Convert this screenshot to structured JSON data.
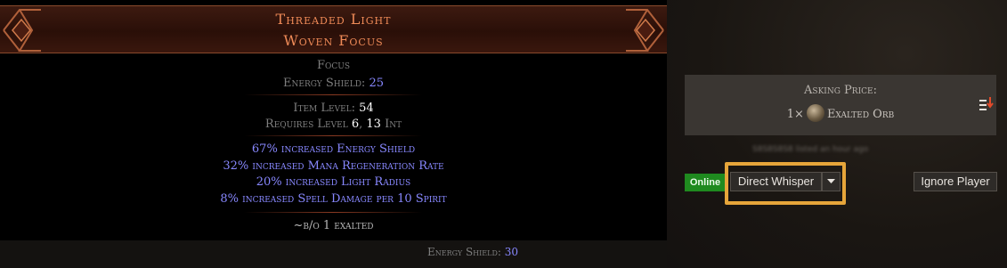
{
  "item": {
    "name_line1": "Threaded Light",
    "name_line2": "Woven Focus",
    "base_type": "Focus",
    "energy_shield_label": "Energy Shield:",
    "energy_shield_value": "25",
    "item_level_label": "Item Level:",
    "item_level_value": "54",
    "requires_prefix": "Requires Level",
    "requires_level": "6",
    "requires_sep": ",",
    "requires_int": "13",
    "requires_int_label": "Int",
    "mods": [
      "67% increased Energy Shield",
      "32% increased Mana Regeneration Rate",
      "20% increased Light Radius",
      "8% increased Spell Damage per 10 Spirit"
    ],
    "note": "~b/o 1 exalted"
  },
  "footer": {
    "energy_shield_label": "Energy Shield:",
    "energy_shield_value": "30"
  },
  "listing": {
    "asking_label": "Asking Price:",
    "price_qty": "1×",
    "currency_name": "Exalted Orb",
    "currency_icon": "exalted-orb-icon",
    "seller_blurred": "S8S8S8S8 listed an hour ago"
  },
  "actions": {
    "online_badge": "Online",
    "direct_whisper": "Direct Whisper",
    "ignore_player": "Ignore Player"
  },
  "colors": {
    "item_name": "#ee8a57",
    "magic_mod": "#8888ff",
    "online": "#1f8a1f",
    "highlight": "#e6a53a"
  }
}
